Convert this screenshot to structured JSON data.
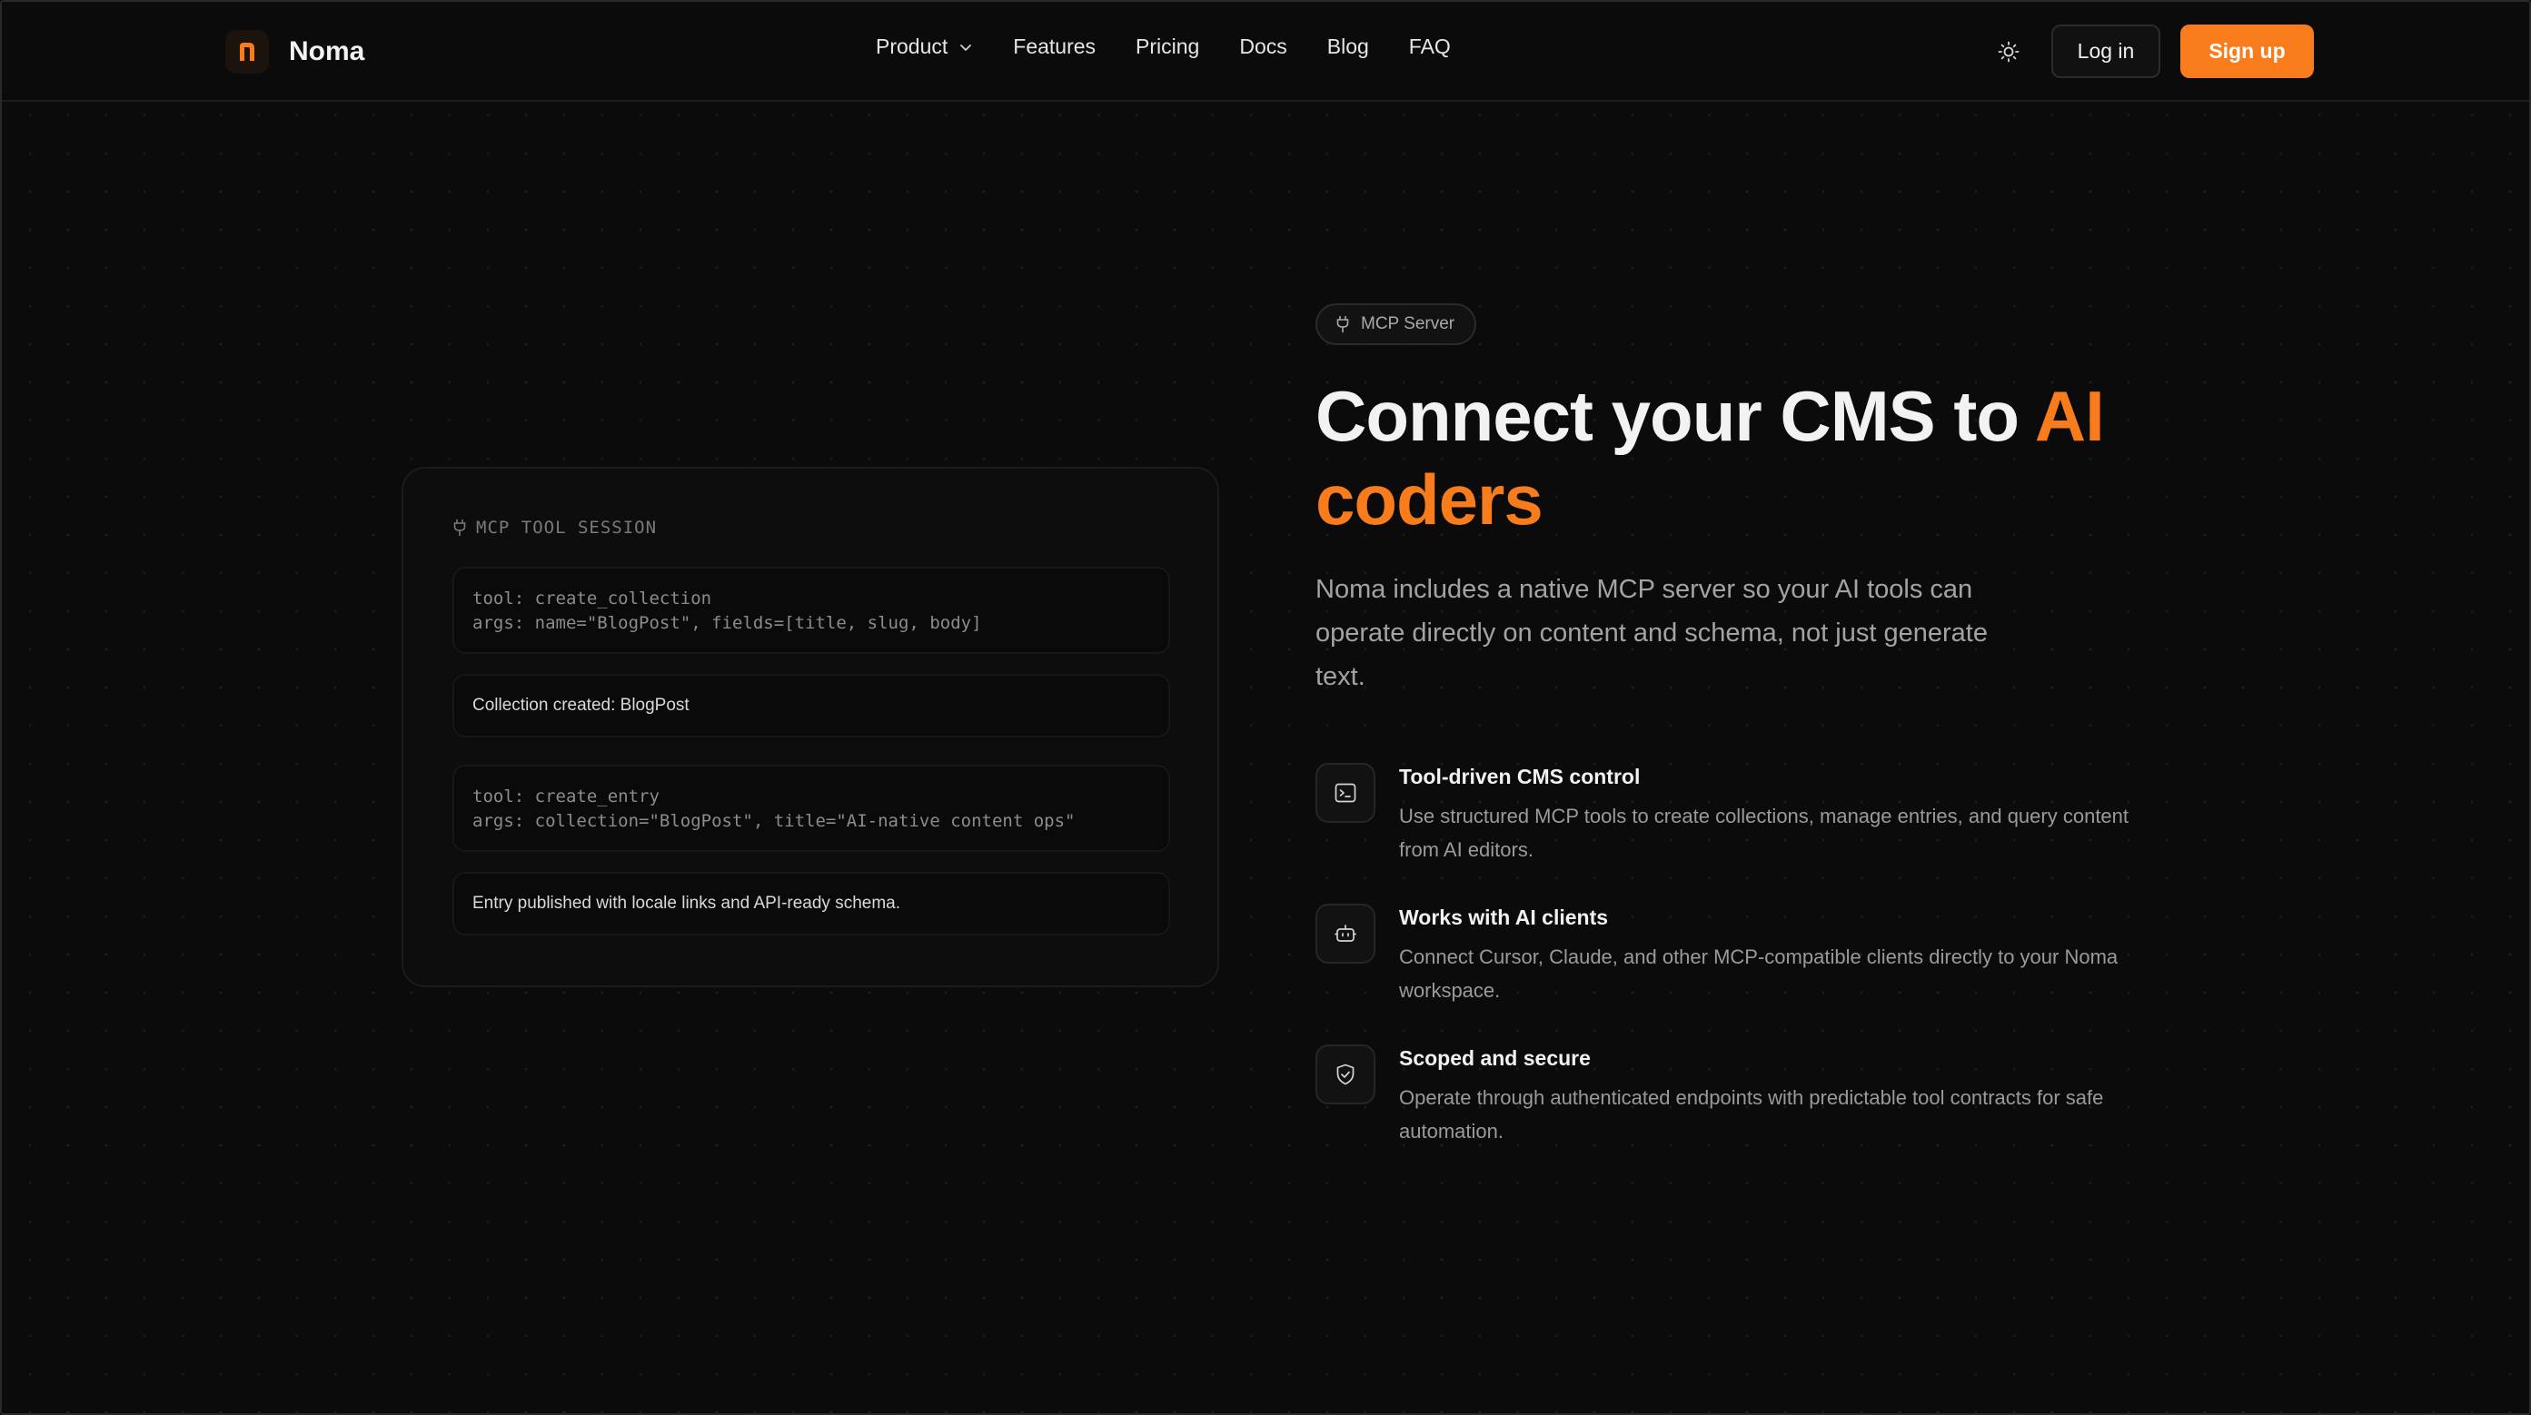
{
  "brand": {
    "name": "Noma",
    "accent": "#f97c1c"
  },
  "nav": {
    "links": [
      {
        "label": "Product",
        "has_dropdown": true
      },
      {
        "label": "Features"
      },
      {
        "label": "Pricing"
      },
      {
        "label": "Docs"
      },
      {
        "label": "Blog"
      },
      {
        "label": "FAQ"
      }
    ],
    "theme_icon": "sun-icon",
    "login_label": "Log in",
    "signup_label": "Sign up"
  },
  "session": {
    "title": "MCP TOOL SESSION",
    "icon": "plug-icon",
    "blocks": [
      {
        "kind": "code",
        "lines": [
          "tool: create_collection",
          "args: name=\"BlogPost\", fields=[title, slug, body]"
        ]
      },
      {
        "kind": "output",
        "text": "Collection created: BlogPost"
      },
      {
        "kind": "code",
        "lines": [
          "tool: create_entry",
          "args: collection=\"BlogPost\", title=\"AI-native content ops\""
        ]
      },
      {
        "kind": "output",
        "text": "Entry published with locale links and API-ready schema."
      }
    ]
  },
  "hero": {
    "badge": "MCP Server",
    "badge_icon": "plug-icon",
    "title_main": "Connect your CMS to ",
    "title_accent": "AI coders",
    "description": "Noma includes a native MCP server so your AI tools can operate directly on content and schema, not just generate text."
  },
  "features": [
    {
      "icon": "terminal-icon",
      "title": "Tool-driven CMS control",
      "description": "Use structured MCP tools to create collections, manage entries, and query content from AI editors."
    },
    {
      "icon": "bot-icon",
      "title": "Works with AI clients",
      "description": "Connect Cursor, Claude, and other MCP-compatible clients directly to your Noma workspace."
    },
    {
      "icon": "shield-check-icon",
      "title": "Scoped and secure",
      "description": "Operate through authenticated endpoints with predictable tool contracts for safe automation."
    }
  ]
}
